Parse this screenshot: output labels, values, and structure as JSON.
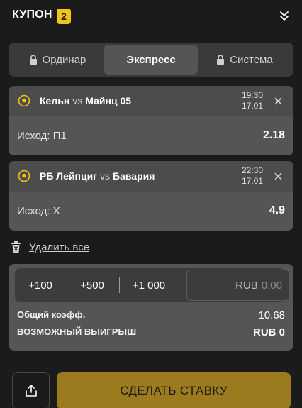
{
  "header": {
    "title": "КУПОН",
    "badge_count": "2"
  },
  "tabs": [
    {
      "label": "Ординар",
      "locked": true,
      "active": false
    },
    {
      "label": "Экспресс",
      "locked": false,
      "active": true
    },
    {
      "label": "Система",
      "locked": true,
      "active": false
    }
  ],
  "bets": [
    {
      "home": "Кельн",
      "vs": "vs",
      "away": "Майнц 05",
      "time": "19:30",
      "date": "17.01",
      "outcome": "Исход: П1",
      "odds": "2.18"
    },
    {
      "home": "РБ Лейпциг",
      "vs": "vs",
      "away": "Бавария",
      "time": "22:30",
      "date": "17.01",
      "outcome": "Исход: X",
      "odds": "4.9"
    }
  ],
  "remove_all": "Удалить все",
  "stake": {
    "quick_amounts": [
      "+100",
      "+500",
      "+1 000"
    ],
    "currency": "RUB",
    "amount_placeholder": "0.00",
    "total_odds_label": "Общий коэфф.",
    "total_odds_value": "10.68",
    "possible_win_label": "ВОЗМОЖНЫЙ ВЫИГРЫШ",
    "possible_win_value": "RUB 0"
  },
  "actions": {
    "place_bet": "СДЕЛАТЬ СТАВКУ"
  },
  "colors": {
    "accent": "#f3c418",
    "bet_button": "#9c7b1e",
    "background": "#1b1b1b",
    "card": "#555555"
  }
}
